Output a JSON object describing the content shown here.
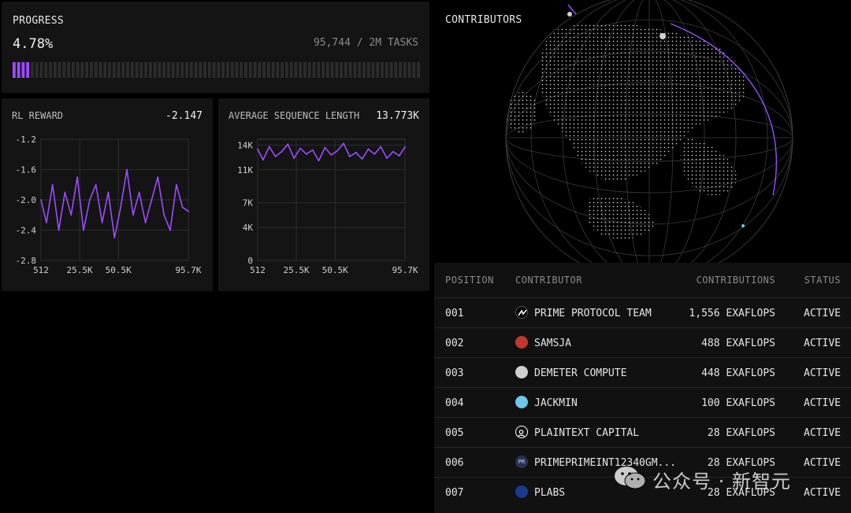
{
  "progress": {
    "title": "PROGRESS",
    "percent": "4.78%",
    "tasks": "95,744 / 2M TASKS",
    "fraction": 0.0478,
    "segments_total": 90,
    "segments_filled": 4
  },
  "rl_reward": {
    "title": "RL REWARD",
    "current": "-2.147"
  },
  "seq_length": {
    "title": "AVERAGE SEQUENCE LENGTH",
    "current": "13.773K"
  },
  "chart_data": [
    {
      "type": "line",
      "title": "RL REWARD",
      "x_ticks": [
        "512",
        "25.5K",
        "50.5K",
        "95.7K"
      ],
      "x_tick_values": [
        512,
        25500,
        50500,
        95700
      ],
      "y_ticks": [
        "-1.2",
        "-1.6",
        "-2.0",
        "-2.4",
        "-2.8"
      ],
      "y_tick_values": [
        -1.2,
        -1.6,
        -2.0,
        -2.4,
        -2.8
      ],
      "ylim": [
        -2.8,
        -1.2
      ],
      "xlim": [
        512,
        95700
      ],
      "series": [
        {
          "color": "#9b4dff",
          "x": [
            512,
            4000,
            8000,
            12000,
            16000,
            20000,
            24000,
            28000,
            32000,
            36000,
            40000,
            44000,
            48000,
            52000,
            56000,
            60000,
            64000,
            68000,
            72000,
            76000,
            80000,
            84000,
            88000,
            92000,
            95700
          ],
          "y": [
            -2.0,
            -2.3,
            -1.8,
            -2.4,
            -1.9,
            -2.2,
            -1.7,
            -2.4,
            -2.0,
            -1.8,
            -2.3,
            -1.9,
            -2.5,
            -2.1,
            -1.6,
            -2.2,
            -1.9,
            -2.3,
            -2.0,
            -1.7,
            -2.2,
            -2.4,
            -1.8,
            -2.1,
            -2.15
          ]
        }
      ],
      "grid": true
    },
    {
      "type": "line",
      "title": "AVERAGE SEQUENCE LENGTH",
      "x_ticks": [
        "512",
        "25.5K",
        "50.5K",
        "95.7K"
      ],
      "x_tick_values": [
        512,
        25500,
        50500,
        95700
      ],
      "y_ticks": [
        "14K",
        "11K",
        "7K",
        "4K",
        "0"
      ],
      "y_tick_values": [
        14000,
        11000,
        7000,
        4000,
        0
      ],
      "ylim": [
        0,
        14700
      ],
      "xlim": [
        512,
        95700
      ],
      "series": [
        {
          "color": "#9b4dff",
          "x": [
            512,
            4000,
            8000,
            12000,
            16000,
            20000,
            24000,
            28000,
            32000,
            36000,
            40000,
            44000,
            48000,
            52000,
            56000,
            60000,
            64000,
            68000,
            72000,
            76000,
            80000,
            84000,
            88000,
            92000,
            95700
          ],
          "y": [
            13500,
            12200,
            13800,
            12600,
            13200,
            14100,
            12400,
            13600,
            12900,
            13400,
            12100,
            13700,
            12800,
            13300,
            14200,
            12600,
            13100,
            12300,
            13500,
            12900,
            13800,
            12400,
            13200,
            12700,
            13773
          ]
        }
      ],
      "grid": true
    }
  ],
  "globe": {
    "title": "CONTRIBUTORS",
    "accent": "#9b4dff"
  },
  "table": {
    "headers": {
      "position": "POSITION",
      "contributor": "CONTRIBUTOR",
      "contributions": "CONTRIBUTIONS",
      "status": "STATUS"
    },
    "rows": [
      {
        "position": "001",
        "name": "PRIME PROTOCOL TEAM",
        "contributions": "1,556 EXAFLOPS",
        "status": "ACTIVE",
        "avatar": "prime-logo-icon",
        "avatar_color": "#ffffff"
      },
      {
        "position": "002",
        "name": "SAMSJA",
        "contributions": "488 EXAFLOPS",
        "status": "ACTIVE",
        "avatar": "user-avatar-icon",
        "avatar_color": "#c0392b"
      },
      {
        "position": "003",
        "name": "DEMETER COMPUTE",
        "contributions": "448 EXAFLOPS",
        "status": "ACTIVE",
        "avatar": "user-avatar-icon",
        "avatar_color": "#cfcfcf"
      },
      {
        "position": "004",
        "name": "JACKMIN",
        "contributions": "100 EXAFLOPS",
        "status": "ACTIVE",
        "avatar": "user-avatar-icon",
        "avatar_color": "#6ec6e8"
      },
      {
        "position": "005",
        "name": "PLAINTEXT CAPITAL",
        "contributions": "28 EXAFLOPS",
        "status": "ACTIVE",
        "avatar": "person-outline-icon",
        "avatar_color": "#ffffff"
      },
      {
        "position": "006",
        "name": "PRIMEPRIMEINT12340GM...",
        "contributions": "28 EXAFLOPS",
        "status": "ACTIVE",
        "avatar": "initials-avatar-icon",
        "avatar_initials": "PR",
        "avatar_color": "#2a3350"
      },
      {
        "position": "007",
        "name": "PLABS",
        "contributions": "28 EXAFLOPS",
        "status": "ACTIVE",
        "avatar": "user-avatar-icon",
        "avatar_color": "#1b3a8c"
      }
    ]
  },
  "watermark": {
    "text": "公众号 · 新智元",
    "icon": "wechat-icon"
  }
}
